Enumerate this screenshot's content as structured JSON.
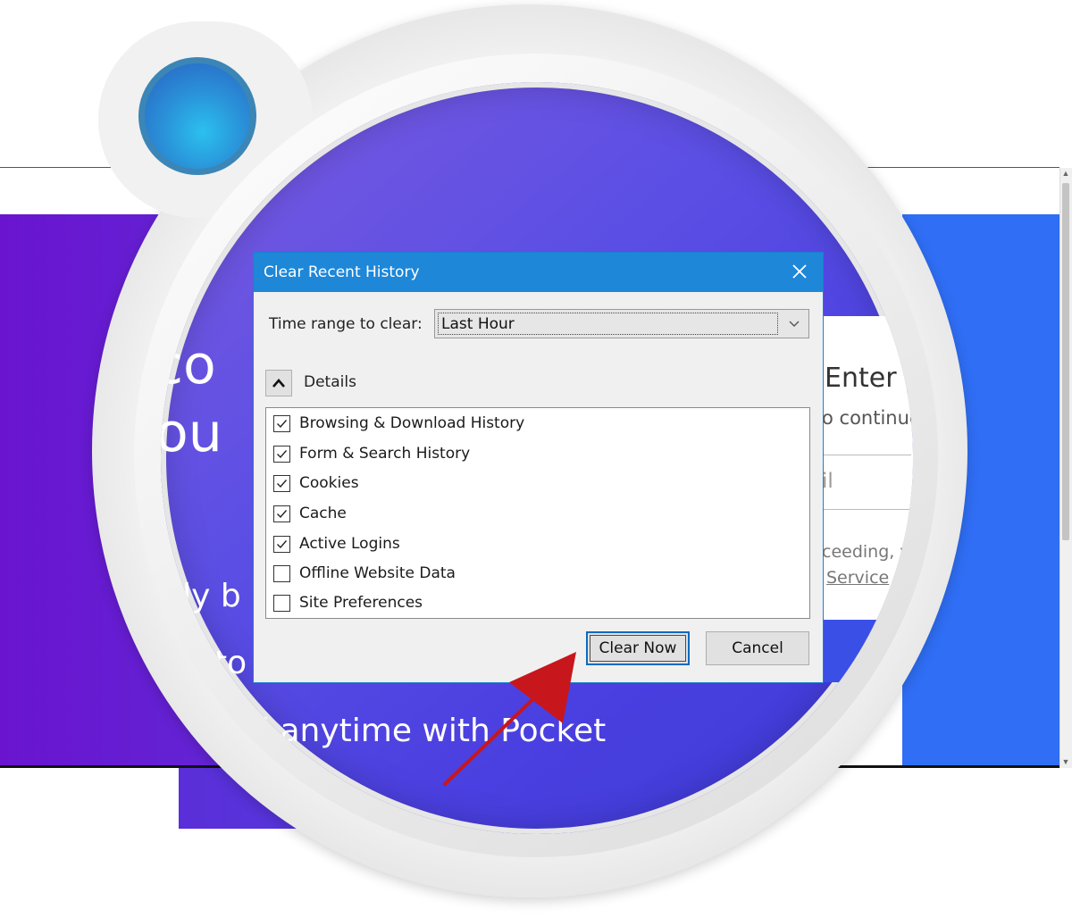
{
  "background_page": {
    "headline_line1": "co",
    "headline_line2": "ou",
    "line_fragment_1": "tly b",
    "line_fragment_2": "to",
    "pocket_line": "l anytime with Pocket",
    "panel_heading": "Enter y",
    "panel_subtext": "o continue",
    "panel_field_hint": "il",
    "panel_legal_1": "ceeding, y",
    "panel_legal_link": "Service"
  },
  "dialog": {
    "title": "Clear Recent History",
    "time_range_label": "Time range to clear:",
    "time_range_value": "Last Hour",
    "details_label": "Details",
    "items": [
      {
        "label": "Browsing & Download History",
        "checked": true
      },
      {
        "label": "Form & Search History",
        "checked": true
      },
      {
        "label": "Cookies",
        "checked": true
      },
      {
        "label": "Cache",
        "checked": true
      },
      {
        "label": "Active Logins",
        "checked": true
      },
      {
        "label": "Offline Website Data",
        "checked": false
      },
      {
        "label": "Site Preferences",
        "checked": false
      }
    ],
    "clear_button": "Clear Now",
    "cancel_button": "Cancel"
  },
  "colors": {
    "titlebar": "#1e87d8",
    "annotation_arrow": "#c8161d",
    "magnifier_dot": "#2a91d8"
  }
}
